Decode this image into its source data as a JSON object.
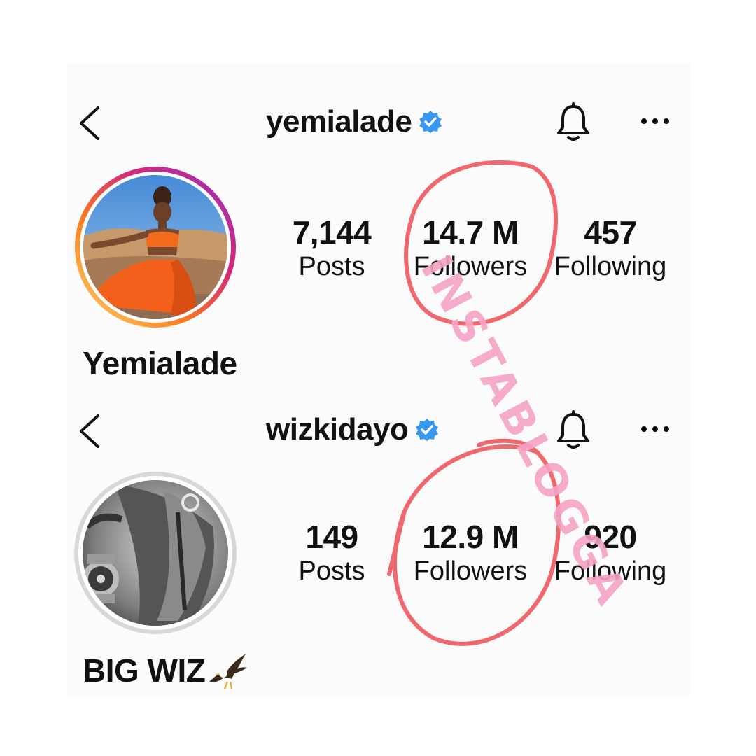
{
  "profiles": [
    {
      "username": "yemialade",
      "display_name": "Yemialade",
      "stats": [
        {
          "value": "7,144",
          "label": "Posts"
        },
        {
          "value": "14.7 M",
          "label": "Followers"
        },
        {
          "value": "457",
          "label": "Following"
        }
      ],
      "avatar_ring": "gradient"
    },
    {
      "username": "wizkidayo",
      "display_name": "BIG WIZ",
      "stats": [
        {
          "value": "149",
          "label": "Posts"
        },
        {
          "value": "12.9 M",
          "label": "Followers"
        },
        {
          "value": "920",
          "label": "Following"
        }
      ],
      "avatar_ring": "grey"
    }
  ],
  "icons": {
    "back": "chevron-left-icon",
    "verified": "verified-badge-icon",
    "notifications": "bell-icon",
    "more": "more-options-icon",
    "name_emoji": "eagle-icon"
  },
  "colors": {
    "verified_blue": "#3897f0",
    "annotation_red": "#f0686e",
    "watermark_pink": "#f5a3c4",
    "ring_start": "#feda75",
    "ring_mid": "#d62976",
    "ring_end": "#962fbf"
  },
  "watermark": "INSTABLOGGA"
}
